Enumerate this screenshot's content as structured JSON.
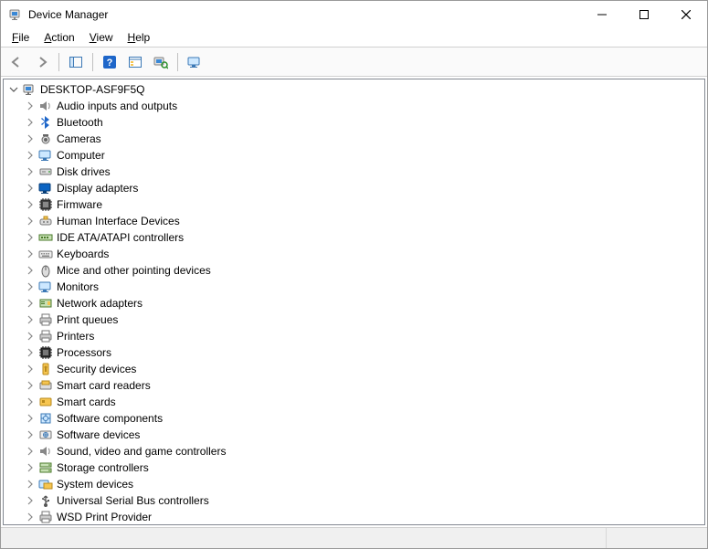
{
  "window": {
    "title": "Device Manager"
  },
  "menubar": {
    "file": {
      "label": "File",
      "accel": "F"
    },
    "action": {
      "label": "Action",
      "accel": "A"
    },
    "view": {
      "label": "View",
      "accel": "V"
    },
    "help": {
      "label": "Help",
      "accel": "H"
    }
  },
  "toolbar": {
    "back_tip": "Back",
    "forward_tip": "Forward",
    "show_hide_tip": "Show/Hide Console Tree",
    "help_tip": "Help",
    "properties_tip": "Properties",
    "update_tip": "Update driver",
    "scan_tip": "Scan for hardware changes"
  },
  "tree": {
    "root": {
      "label": "DESKTOP-ASF9F5Q",
      "expanded": true
    },
    "categories": [
      {
        "label": "Audio inputs and outputs",
        "icon": "speaker"
      },
      {
        "label": "Bluetooth",
        "icon": "bluetooth"
      },
      {
        "label": "Cameras",
        "icon": "camera"
      },
      {
        "label": "Computer",
        "icon": "monitor"
      },
      {
        "label": "Disk drives",
        "icon": "disk"
      },
      {
        "label": "Display adapters",
        "icon": "display"
      },
      {
        "label": "Firmware",
        "icon": "chip"
      },
      {
        "label": "Human Interface Devices",
        "icon": "hid"
      },
      {
        "label": "IDE ATA/ATAPI controllers",
        "icon": "ide"
      },
      {
        "label": "Keyboards",
        "icon": "keyboard"
      },
      {
        "label": "Mice and other pointing devices",
        "icon": "mouse"
      },
      {
        "label": "Monitors",
        "icon": "monitor"
      },
      {
        "label": "Network adapters",
        "icon": "nic"
      },
      {
        "label": "Print queues",
        "icon": "printer"
      },
      {
        "label": "Printers",
        "icon": "printer"
      },
      {
        "label": "Processors",
        "icon": "cpu"
      },
      {
        "label": "Security devices",
        "icon": "security"
      },
      {
        "label": "Smart card readers",
        "icon": "smartcardreader"
      },
      {
        "label": "Smart cards",
        "icon": "smartcard"
      },
      {
        "label": "Software components",
        "icon": "swcomp"
      },
      {
        "label": "Software devices",
        "icon": "swdev"
      },
      {
        "label": "Sound, video and game controllers",
        "icon": "speaker"
      },
      {
        "label": "Storage controllers",
        "icon": "storage"
      },
      {
        "label": "System devices",
        "icon": "system"
      },
      {
        "label": "Universal Serial Bus controllers",
        "icon": "usb"
      },
      {
        "label": "WSD Print Provider",
        "icon": "printer"
      }
    ]
  }
}
